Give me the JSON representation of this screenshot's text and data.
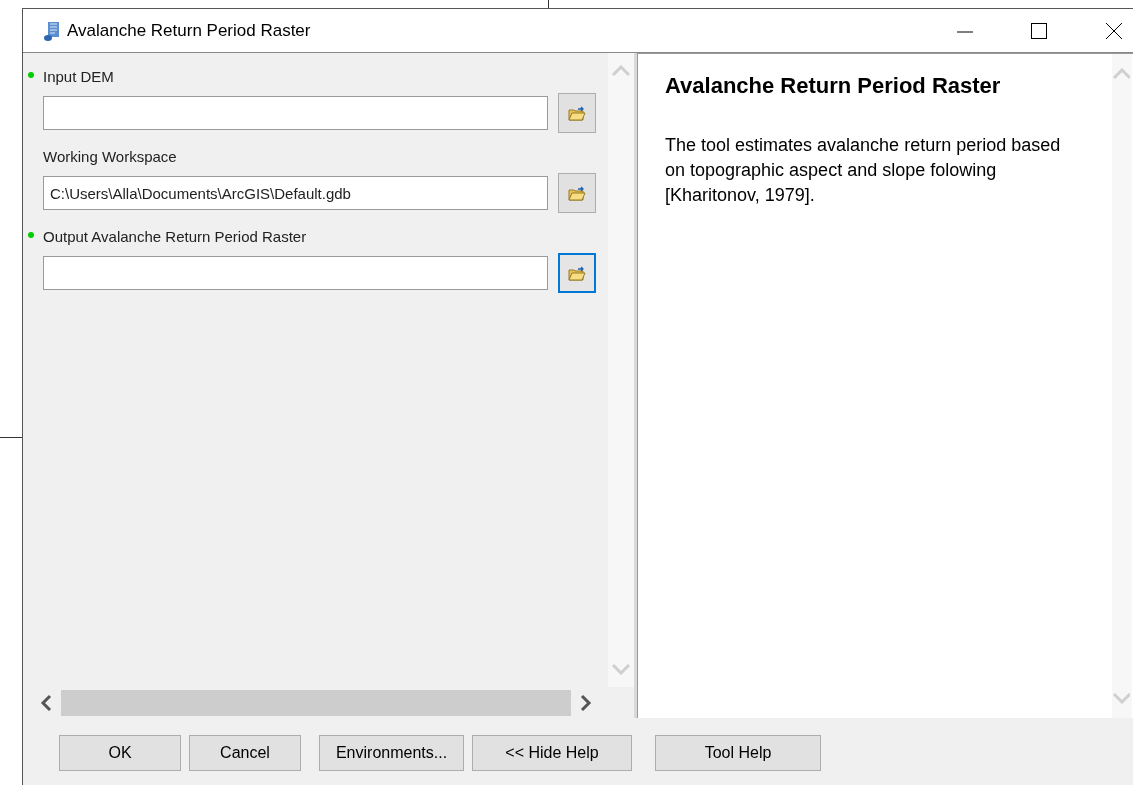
{
  "window": {
    "title": "Avalanche Return Period Raster"
  },
  "parameters": [
    {
      "label": "Input DEM",
      "required": true,
      "focused": false
    },
    {
      "label": "Working Workspace",
      "required": false,
      "value": "C:\\Users\\Alla\\Documents\\ArcGIS\\Default.gdb",
      "focused": false
    },
    {
      "label": "Output Avalanche Return Period Raster",
      "required": true,
      "focused": true
    }
  ],
  "help": {
    "title": "Avalanche Return Period Raster",
    "text": "The tool estimates avalanche return period based on topographic aspect and slope folowing [Kharitonov, 1979]."
  },
  "buttons": [
    {
      "label": "OK"
    },
    {
      "label": "Cancel"
    },
    {
      "label": "Environments..."
    },
    {
      "label": "<< Hide Help"
    },
    {
      "label": "Tool Help"
    }
  ]
}
